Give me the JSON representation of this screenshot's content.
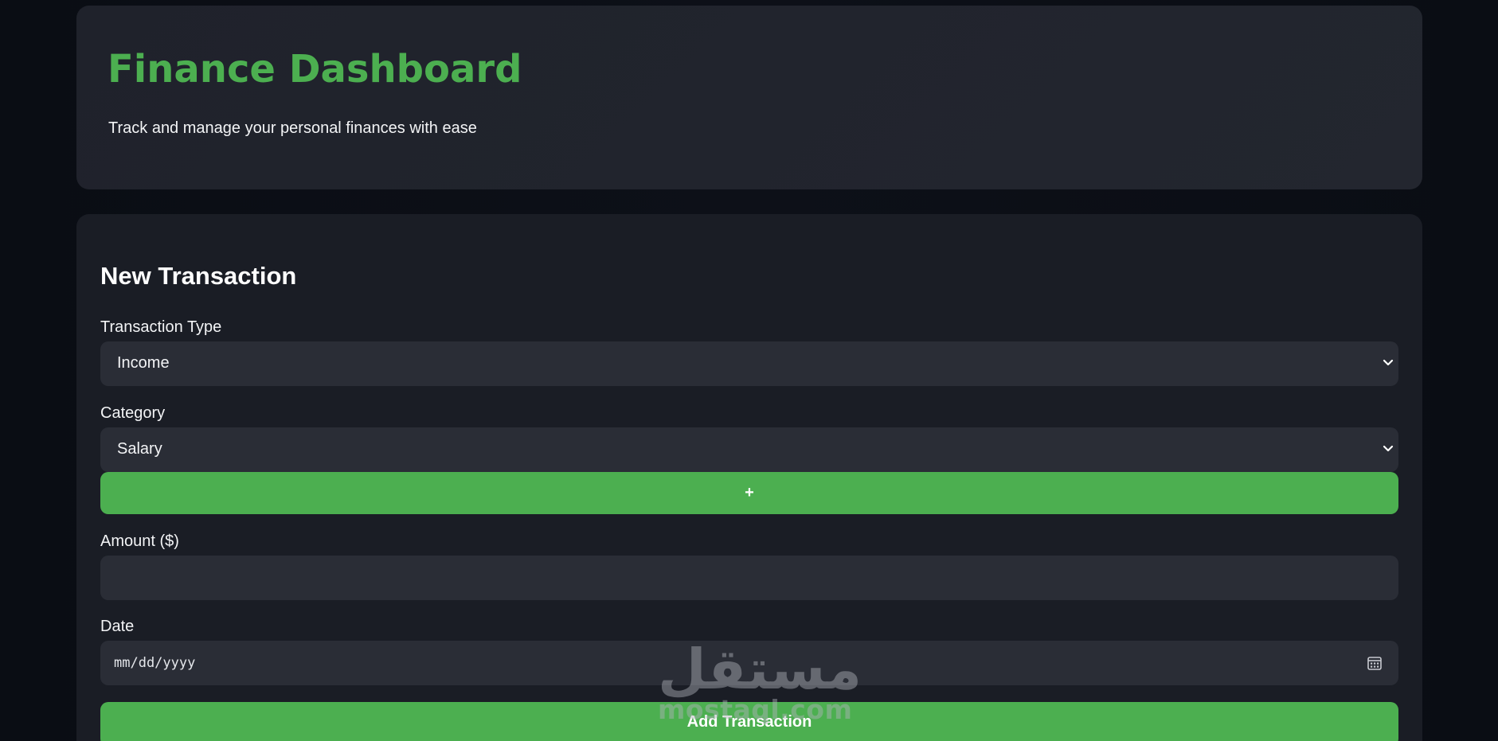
{
  "header": {
    "title": "Finance Dashboard",
    "subtitle": "Track and manage your personal finances with ease"
  },
  "form": {
    "title": "New Transaction",
    "transaction_type": {
      "label": "Transaction Type",
      "selected": "Income"
    },
    "category": {
      "label": "Category",
      "selected": "Salary"
    },
    "add_category_label": "+",
    "amount": {
      "label": "Amount ($)",
      "value": ""
    },
    "date": {
      "label": "Date",
      "placeholder": "mm/dd/yyyy"
    },
    "submit_label": "Add Transaction"
  },
  "watermark": {
    "arabic": "مستقل",
    "latin": "mostaql.com"
  },
  "colors": {
    "accent": "#4caf50",
    "background": "#0b0e15",
    "card": "#1a1d25",
    "control": "#2a2d36"
  },
  "icons": {
    "select_arrow": "chevron-down-icon",
    "date_picker": "calendar-icon"
  }
}
